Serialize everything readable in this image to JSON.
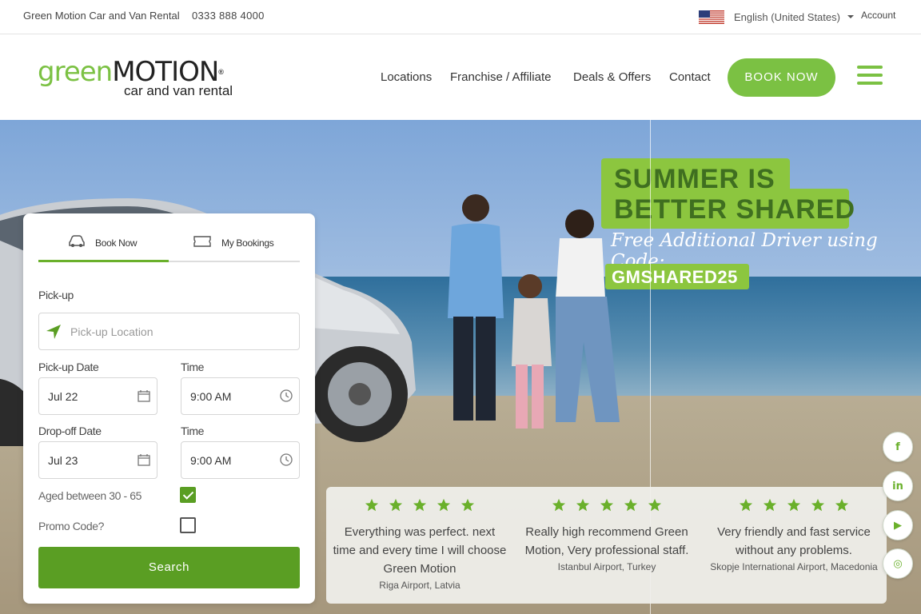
{
  "topbar": {
    "brand_text": "Green Motion Car and Van Rental",
    "phone": "0333 888 4000",
    "language": "English (United States)",
    "account": "Account",
    "flag_icon": "us-flag-icon"
  },
  "header": {
    "logo_green": "green",
    "logo_dark": "MOTION",
    "logo_tagline": "car and van rental",
    "nav": [
      "Locations",
      "Franchise / Affiliate",
      "Deals & Offers",
      "Contact"
    ],
    "book_now": "BOOK NOW",
    "menu_icon": "hamburger-menu-icon"
  },
  "promo": {
    "line1": "SUMMER IS",
    "line2": "BETTER SHARED",
    "line3": "Free Additional Driver using Code:",
    "code": "GMSHARED25"
  },
  "booking": {
    "tabs": [
      {
        "label": "Book Now",
        "icon": "car-icon",
        "active": true
      },
      {
        "label": "My Bookings",
        "icon": "ticket-icon",
        "active": false
      }
    ],
    "pickup_label": "Pick-up",
    "pickup_placeholder": "Pick-up Location",
    "pickup_date_label": "Pick-up Date",
    "pickup_date": "Jul 22",
    "pickup_time_label": "Time",
    "pickup_time": "9:00 AM",
    "dropoff_date_label": "Drop-off Date",
    "dropoff_date": "Jul 23",
    "dropoff_time_label": "Time",
    "dropoff_time": "9:00 AM",
    "age_label": "Aged between 30 - 65",
    "age_checked": true,
    "promo_label": "Promo Code?",
    "promo_checked": false,
    "search": "Search"
  },
  "reviews": [
    {
      "rating": 5,
      "text": "Everything was perfect. next time and every time I will choose Green Motion",
      "location": "Riga Airport, Latvia"
    },
    {
      "rating": 5,
      "text": "Really high recommend Green Motion, Very professional staff.",
      "location": "Istanbul Airport, Turkey"
    },
    {
      "rating": 5,
      "text": "Very friendly and fast service without any problems.",
      "location": "Skopje International Airport, Macedonia"
    }
  ],
  "social": [
    {
      "icon": "facebook-icon",
      "glyph": "f"
    },
    {
      "icon": "linkedin-icon",
      "glyph": "in"
    },
    {
      "icon": "youtube-icon",
      "glyph": "▶"
    },
    {
      "icon": "instagram-icon",
      "glyph": "◎"
    }
  ],
  "colors": {
    "brand_green": "#7bc143",
    "button_green": "#5a9e23",
    "promo_green": "#8cc63f"
  }
}
